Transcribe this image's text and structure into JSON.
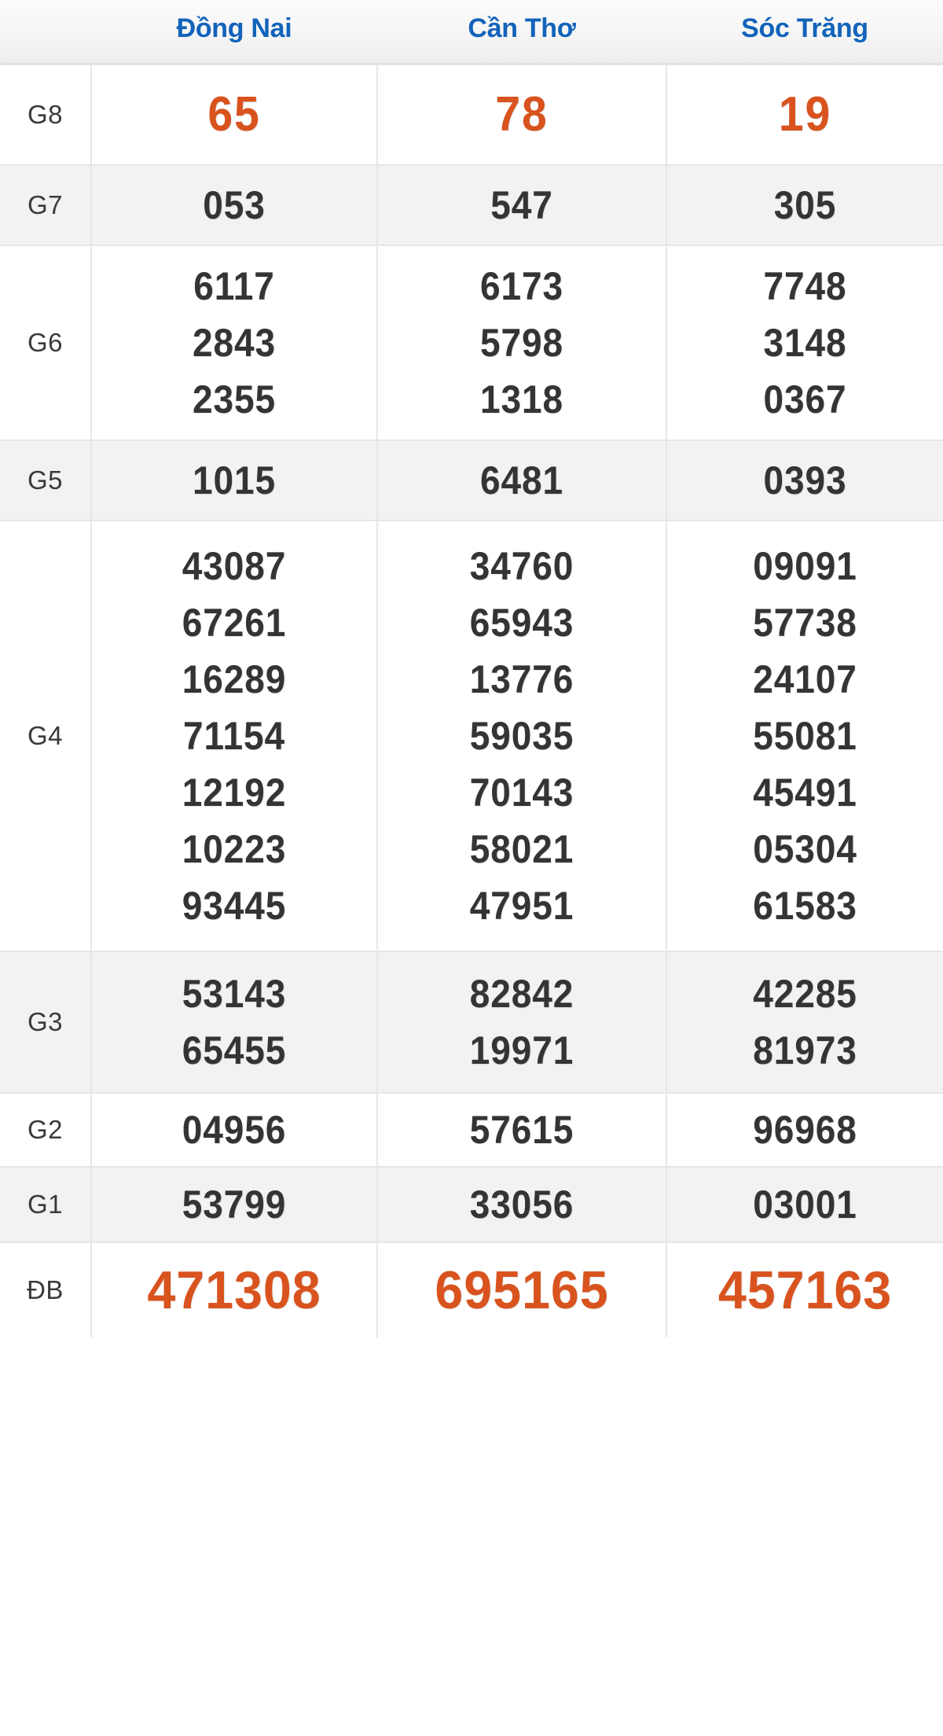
{
  "header": {
    "corner_label": "",
    "provinces": [
      "Đồng Nai",
      "Cần Thơ",
      "Sóc Trăng"
    ],
    "province_color": "#1263ba"
  },
  "colors": {
    "accent_orange": "#d9531e",
    "number_dark": "#343434",
    "label_gray": "#3a3a3a",
    "row_alt_bg": "#f2f2f2",
    "row_bg": "#ffffff",
    "border": "#e6e6e6"
  },
  "table": {
    "prize_rows": [
      {
        "label": "G8",
        "style": "accent",
        "cells": [
          [
            "65"
          ],
          [
            "78"
          ],
          [
            "19"
          ]
        ]
      },
      {
        "label": "G7",
        "style": "normal",
        "cells": [
          [
            "053"
          ],
          [
            "547"
          ],
          [
            "305"
          ]
        ]
      },
      {
        "label": "G6",
        "style": "normal",
        "cells": [
          [
            "6117",
            "2843",
            "2355"
          ],
          [
            "6173",
            "5798",
            "1318"
          ],
          [
            "7748",
            "3148",
            "0367"
          ]
        ]
      },
      {
        "label": "G5",
        "style": "normal",
        "cells": [
          [
            "1015"
          ],
          [
            "6481"
          ],
          [
            "0393"
          ]
        ]
      },
      {
        "label": "G4",
        "style": "normal",
        "cells": [
          [
            "43087",
            "67261",
            "16289",
            "71154",
            "12192",
            "10223",
            "93445"
          ],
          [
            "34760",
            "65943",
            "13776",
            "59035",
            "70143",
            "58021",
            "47951"
          ],
          [
            "09091",
            "57738",
            "24107",
            "55081",
            "45491",
            "05304",
            "61583"
          ]
        ]
      },
      {
        "label": "G3",
        "style": "normal",
        "cells": [
          [
            "53143",
            "65455"
          ],
          [
            "82842",
            "19971"
          ],
          [
            "42285",
            "81973"
          ]
        ]
      },
      {
        "label": "G2",
        "style": "normal",
        "cells": [
          [
            "04956"
          ],
          [
            "57615"
          ],
          [
            "96968"
          ]
        ]
      },
      {
        "label": "G1",
        "style": "normal",
        "cells": [
          [
            "53799"
          ],
          [
            "33056"
          ],
          [
            "03001"
          ]
        ]
      },
      {
        "label": "ĐB",
        "style": "accent",
        "cells": [
          [
            "471308"
          ],
          [
            "695165"
          ],
          [
            "457163"
          ]
        ]
      }
    ]
  }
}
